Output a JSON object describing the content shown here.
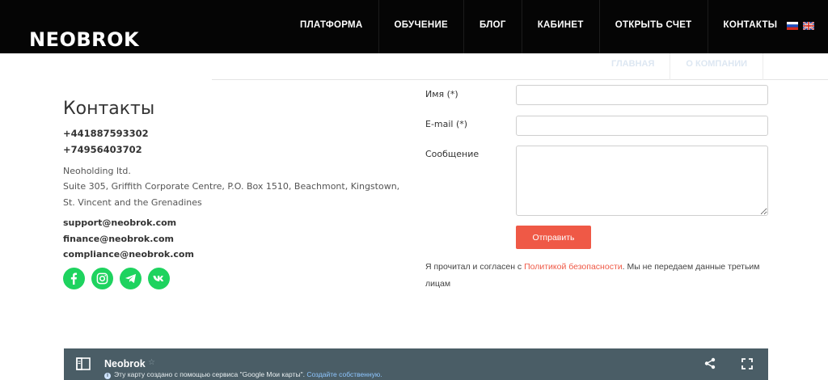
{
  "header": {
    "logo": "NEOBROK",
    "nav": [
      "ПЛАТФОРМА",
      "ОБУЧЕНИЕ",
      "БЛОГ",
      "КАБИНЕТ",
      "ОТКРЫТЬ СЧЕТ",
      "КОНТАКТЫ"
    ],
    "flags": [
      "flag-ru-icon",
      "flag-uk-icon"
    ]
  },
  "subtabs": [
    "ГЛАВНАЯ",
    "О КОМПАНИИ"
  ],
  "contacts": {
    "title": "Контакты",
    "phones": [
      "+441887593302",
      "+74956403702"
    ],
    "company": "Neoholding ltd.",
    "address": "Suite 305, Griffith Corporate Centre, P.O. Box 1510, Beachmont, Kingstown, St. Vincent and the Grenadines",
    "emails": [
      "support@neobrok.com",
      "finance@neobrok.com",
      "compliance@neobrok.com"
    ],
    "socials": [
      "facebook-icon",
      "instagram-icon",
      "telegram-icon",
      "vk-icon"
    ],
    "social_color": "#1ed35f"
  },
  "form": {
    "name_label": "Имя (*)",
    "email_label": "E-mail (*)",
    "message_label": "Сообщение",
    "name_value": "",
    "email_value": "",
    "message_value": "",
    "submit_label": "Отправить",
    "submit_color": "#ef5946",
    "consent_before": "Я прочитал и согласен с ",
    "consent_link": "Политикой безопасности",
    "consent_after": ". Мы не передаем данные третьим лицам"
  },
  "map": {
    "title": "Neobrok",
    "note_text": "Эту карту создано с помощью сервиса \"Google Мои карты\". ",
    "note_link": "Создайте собственную.",
    "bar_color": "#4a5d66"
  }
}
